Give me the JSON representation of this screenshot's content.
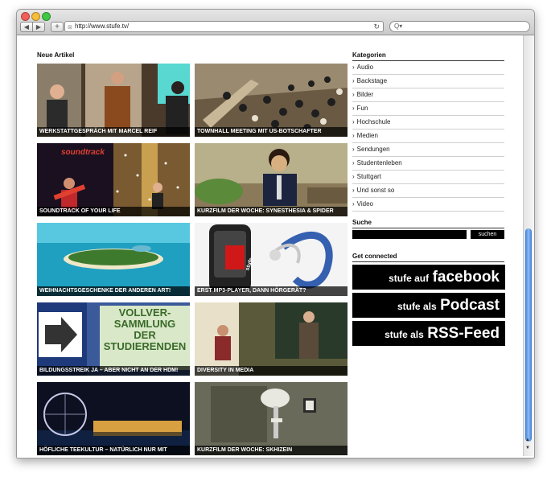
{
  "browser": {
    "url": "http://www.stufe.tv/",
    "search_placeholder": "",
    "back_glyph": "◀",
    "forward_glyph": "▶",
    "add_glyph": "+",
    "reload_glyph": "↻",
    "search_glyph": "Q▾"
  },
  "main": {
    "title": "Neue Artikel",
    "tiles": [
      {
        "caption": "Werkstattgespräch mit Marcel Reif"
      },
      {
        "caption": "Townhall Meeting mit US-Botschafter"
      },
      {
        "caption": "Soundtrack of your life"
      },
      {
        "caption": "Kurzfilm der Woche: Synesthesia & Spider"
      },
      {
        "caption": "Weihnachtsgeschenke der anderen Art!"
      },
      {
        "caption": "Erst MP3-Player, dann Hörgerät?"
      },
      {
        "caption": "Bildungsstreik ja – aber nicht an der HdM!"
      },
      {
        "caption": "Diversity in Media"
      },
      {
        "caption": "Höfliche Teekultur – natürlich nur mit"
      },
      {
        "caption": "Kurzfilm der Woche: Skhizein"
      }
    ],
    "tile3_text": "soundtrack",
    "tile7_text": "VOLLVER- SAMMLUNG DER STUDIERENDEN",
    "tile6_text": "stufe"
  },
  "sidebar": {
    "categories_title": "Kategorien",
    "arrow": "›",
    "categories": [
      "Audio",
      "Backstage",
      "Bilder",
      "Fun",
      "Hochschule",
      "Medien",
      "Sendungen",
      "Studentenleben",
      "Stuttgart",
      "Und sonst so",
      "Video"
    ],
    "search_title": "Suche",
    "search_button": "suchen",
    "connect_title": "Get connected",
    "banners": [
      {
        "small": "stufe auf",
        "big": "facebook"
      },
      {
        "small": "stufe als",
        "big": "Podcast"
      },
      {
        "small": "stufe als",
        "big": "RSS-Feed"
      }
    ]
  },
  "colors": {
    "accent": "#3b7ad6",
    "caption_bg": "#000000",
    "banner_bg": "#000000"
  }
}
